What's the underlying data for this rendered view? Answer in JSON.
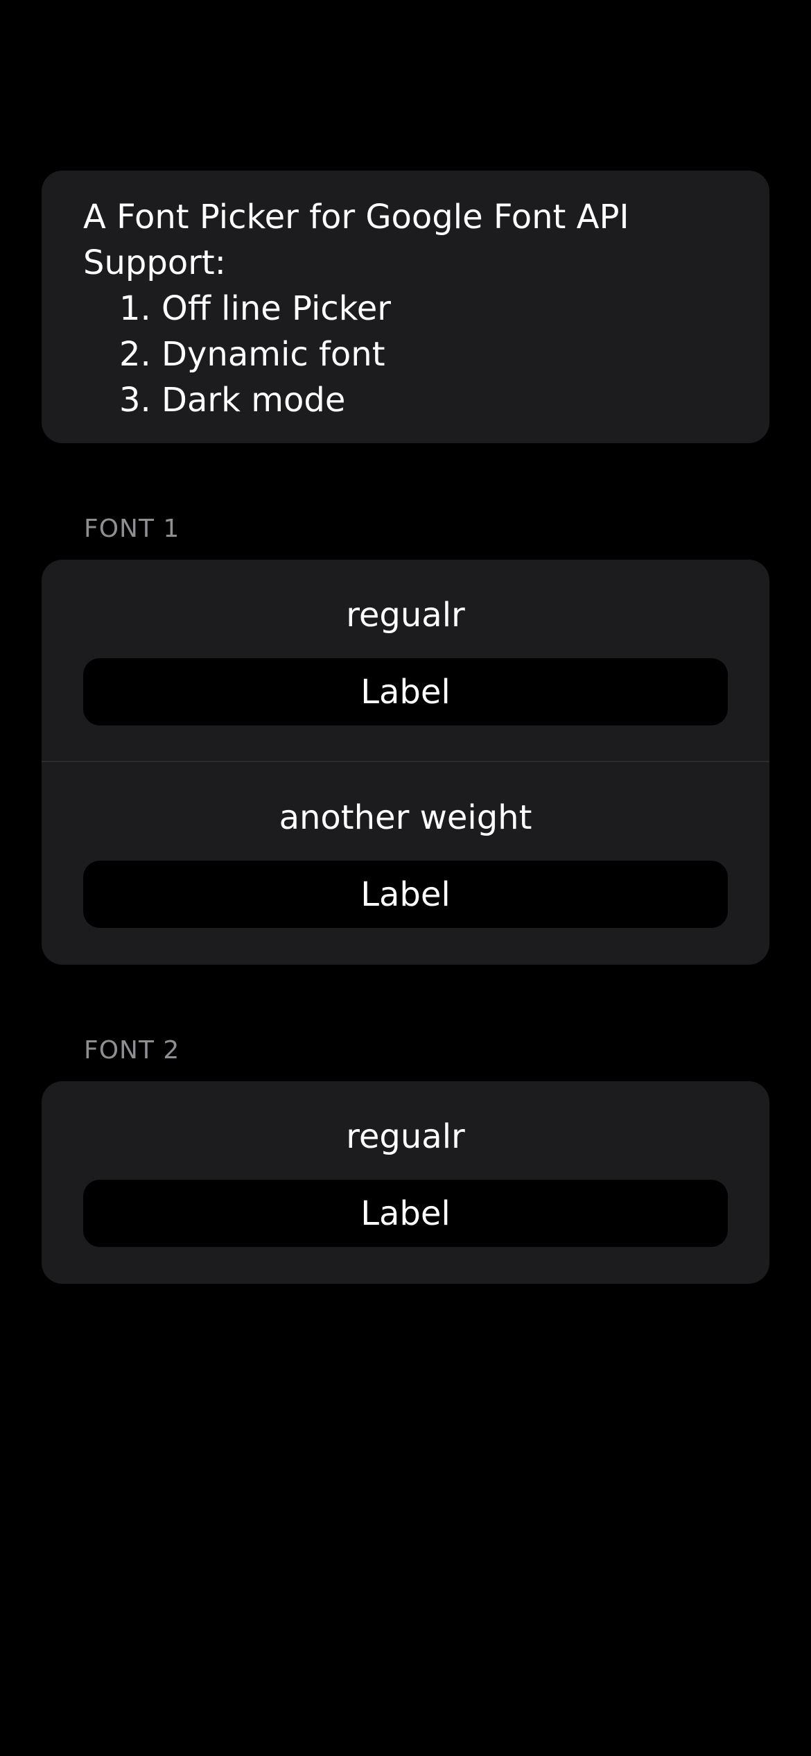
{
  "intro": {
    "title": "A Font Picker for Google Font API",
    "support_label": "Support:",
    "features": [
      "1. Off line Picker",
      "2. Dynamic font",
      "3. Dark mode"
    ]
  },
  "sections": [
    {
      "header": "FONT 1",
      "rows": [
        {
          "weight": "regualr",
          "label": "Label"
        },
        {
          "weight": "another weight",
          "label": "Label"
        }
      ]
    },
    {
      "header": "FONT 2",
      "rows": [
        {
          "weight": "regualr",
          "label": "Label"
        }
      ]
    }
  ],
  "colors": {
    "background": "#000000",
    "card": "#1C1C1E",
    "header_text": "#8E8E93",
    "text": "#FFFFFF"
  }
}
